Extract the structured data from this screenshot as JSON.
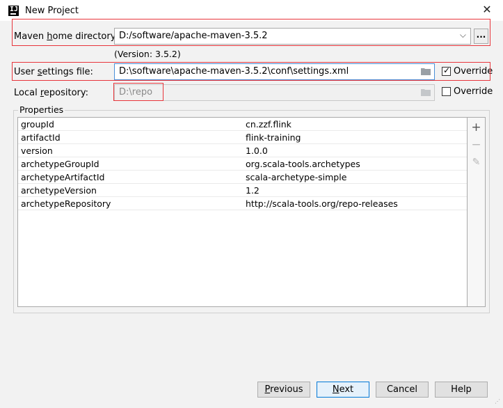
{
  "window": {
    "title": "New Project"
  },
  "maven_home": {
    "label_pre": "Maven ",
    "label_accel": "h",
    "label_post": "ome directory:",
    "value": "D:/software/apache-maven-3.5.2",
    "browse_label": "...",
    "version_text": "(Version: 3.5.2)"
  },
  "user_settings": {
    "label_pre": "User ",
    "label_accel": "s",
    "label_post": "ettings file:",
    "value": "D:\\software\\apache-maven-3.5.2\\conf\\settings.xml",
    "override_label": "Override",
    "override_checked": true,
    "check_glyph": "✓"
  },
  "local_repo": {
    "label_pre": "Local ",
    "label_accel": "r",
    "label_post": "epository:",
    "value": "D:\\repo",
    "override_label": "Override",
    "override_checked": false
  },
  "properties": {
    "legend": "Properties",
    "rows": [
      {
        "key": "groupId",
        "value": "cn.zzf.flink"
      },
      {
        "key": "artifactId",
        "value": "flink-training"
      },
      {
        "key": "version",
        "value": "1.0.0"
      },
      {
        "key": "archetypeGroupId",
        "value": "org.scala-tools.archetypes"
      },
      {
        "key": "archetypeArtifactId",
        "value": "scala-archetype-simple"
      },
      {
        "key": "archetypeVersion",
        "value": "1.2"
      },
      {
        "key": "archetypeRepository",
        "value": "http://scala-tools.org/repo-releases"
      }
    ],
    "add_glyph": "+",
    "remove_glyph": "−",
    "edit_glyph": "✎"
  },
  "buttons": {
    "previous_accel": "P",
    "previous_rest": "revious",
    "next_accel": "N",
    "next_rest": "ext",
    "cancel": "Cancel",
    "help": "Help"
  },
  "colors": {
    "highlight": "#e8343a",
    "primary_border": "#0078d7"
  }
}
